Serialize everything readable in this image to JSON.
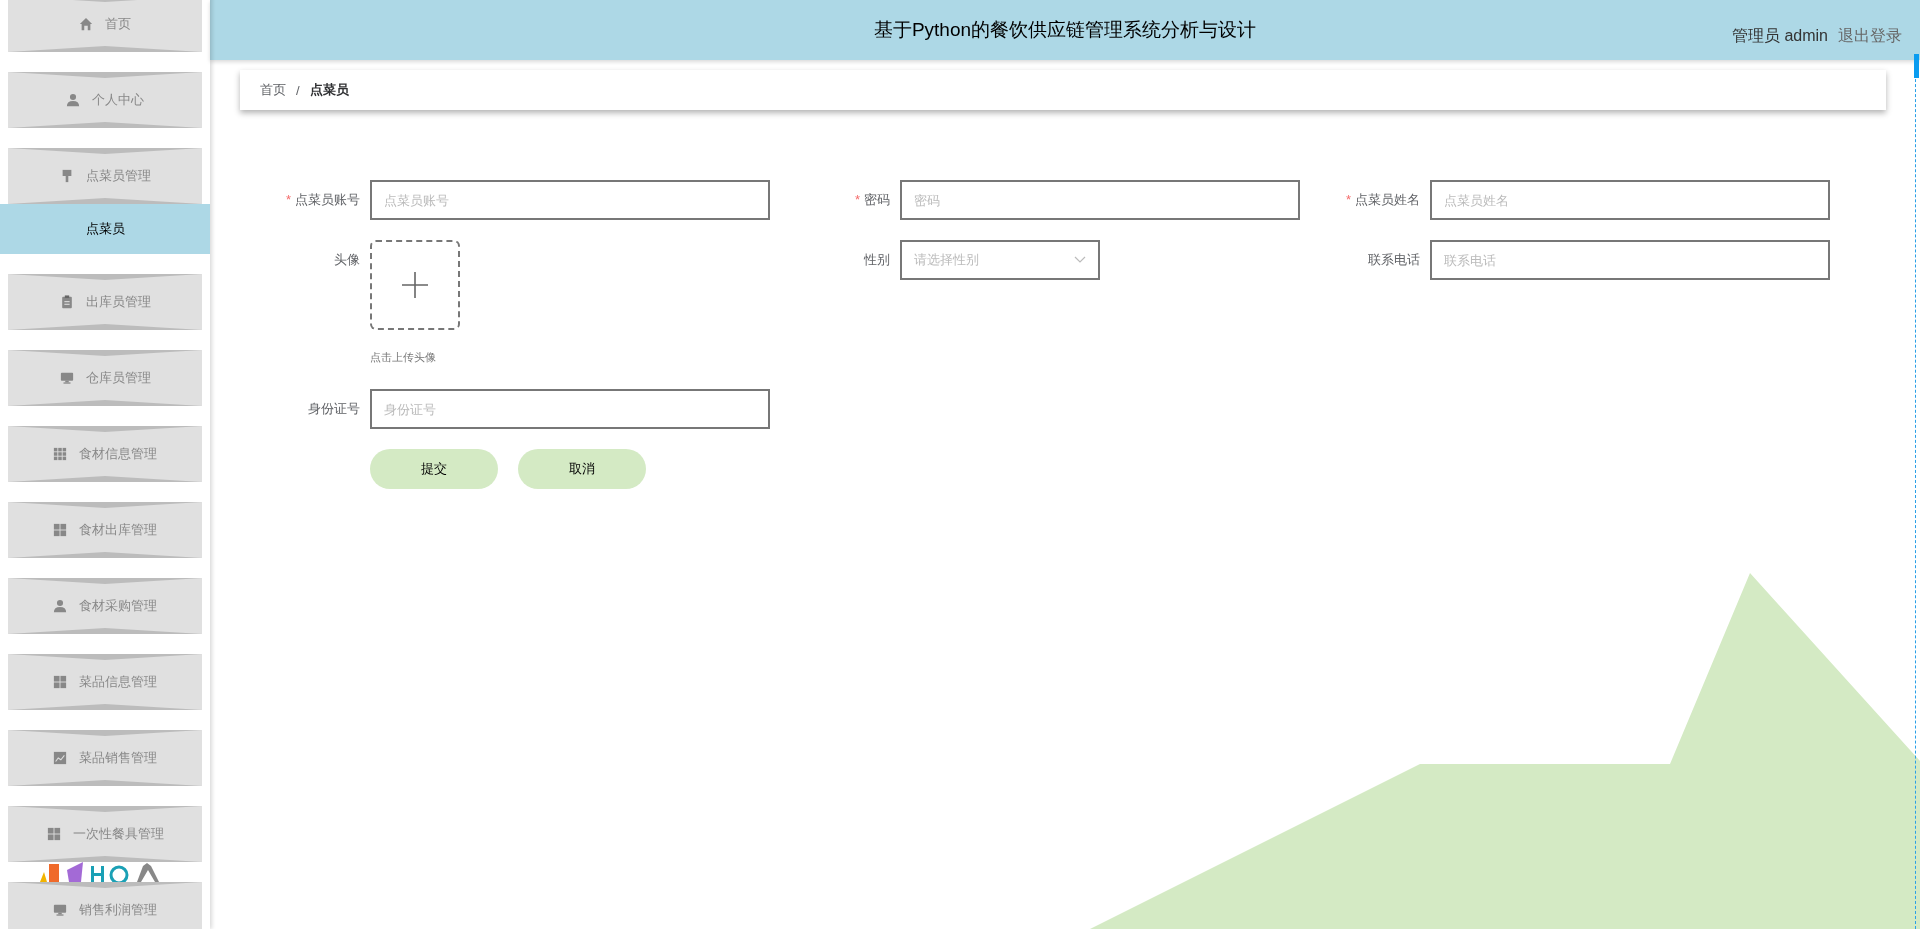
{
  "header": {
    "title": "基于Python的餐饮供应链管理系统分析与设计",
    "user": "管理员 admin",
    "logout": "退出登录"
  },
  "sidebar": {
    "items": [
      {
        "label": "首页",
        "selected": false
      },
      {
        "label": "个人中心",
        "selected": false
      },
      {
        "label": "点菜员管理",
        "selected": false,
        "children": [
          {
            "label": "点菜员",
            "selected": true
          }
        ]
      },
      {
        "label": "出库员管理",
        "selected": false
      },
      {
        "label": "仓库员管理",
        "selected": false
      },
      {
        "label": "食材信息管理",
        "selected": false
      },
      {
        "label": "食材出库管理",
        "selected": false
      },
      {
        "label": "食材采购管理",
        "selected": false
      },
      {
        "label": "菜品信息管理",
        "selected": false
      },
      {
        "label": "菜品销售管理",
        "selected": false
      },
      {
        "label": "一次性餐具管理",
        "selected": false
      },
      {
        "label": "销售利润管理",
        "selected": false
      }
    ]
  },
  "breadcrumb": {
    "separator": "/",
    "items": [
      "首页",
      "点菜员"
    ]
  },
  "form": {
    "fields": [
      {
        "kind": "text",
        "label": "点菜员账号",
        "required_mark": "*",
        "placeholder": "点菜员账号"
      },
      {
        "kind": "text",
        "label": "密码",
        "required_mark": "*",
        "placeholder": "密码"
      },
      {
        "kind": "text",
        "label": "点菜员姓名",
        "required_mark": "*",
        "placeholder": "点菜员姓名"
      },
      {
        "kind": "upload",
        "label": "头像",
        "tip": "点击上传头像"
      },
      {
        "kind": "select",
        "label": "性别",
        "placeholder": "请选择性别"
      },
      {
        "kind": "text",
        "label": "联系电话",
        "placeholder": "联系电话"
      },
      {
        "kind": "text",
        "label": "身份证号",
        "placeholder": "身份证号"
      }
    ],
    "buttons": [
      "提交",
      "取消"
    ]
  }
}
